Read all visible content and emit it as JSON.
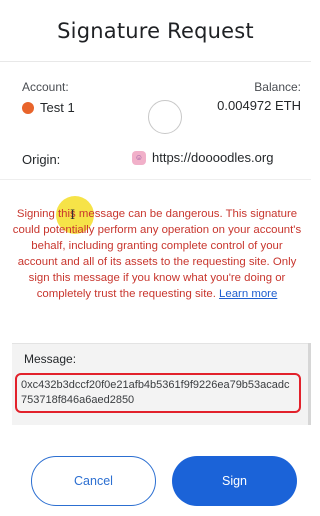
{
  "header": {
    "title": "Signature Request"
  },
  "account": {
    "label": "Account:",
    "name": "Test 1",
    "balance_label": "Balance:",
    "balance_value": "0.004972 ETH",
    "avatar_color": "#e8642b"
  },
  "origin": {
    "label": "Origin:",
    "url": "https://doooodles.org",
    "icon": "site-favicon-icon"
  },
  "warning": {
    "text": "Signing this message can be dangerous. This signature could potentially perform any operation on your account's behalf, including granting complete control of your account and all of its assets to the requesting site. Only sign this message if you know what you're doing or completely trust the requesting site.",
    "link": "Learn more",
    "color": "#c8362e"
  },
  "message": {
    "label": "Message:",
    "value": "0xc432b3dccf20f0e21afb4b5361f9f9226ea79b53acadc753718f846a6aed2850"
  },
  "buttons": {
    "cancel": "Cancel",
    "sign": "Sign",
    "accent": "#1b63d8"
  }
}
